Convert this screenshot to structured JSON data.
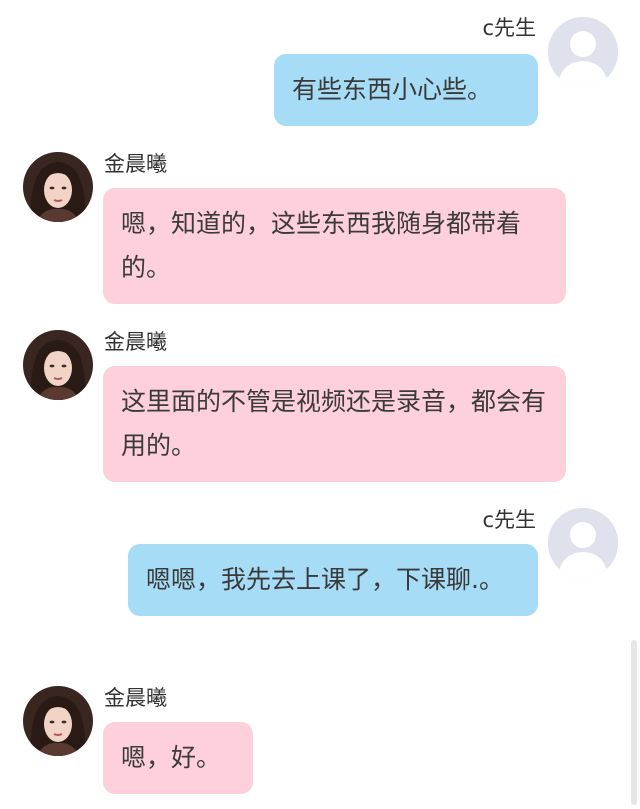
{
  "contacts": {
    "me": {
      "name": "c先生"
    },
    "other": {
      "name": "金晨曦"
    }
  },
  "messages": [
    {
      "sender": "c先生",
      "text": "有些东西小心些。"
    },
    {
      "sender": "金晨曦",
      "text": "嗯，知道的，这些东西我随身都带着的。"
    },
    {
      "sender": "金晨曦",
      "text": "这里面的不管是视频还是录音，都会有用的。"
    },
    {
      "sender": "c先生",
      "text": "嗯嗯，我先去上课了，下课聊.。"
    },
    {
      "sender": "金晨曦",
      "text": "嗯，好。"
    }
  ],
  "colors": {
    "outgoing_bubble": "#a7dcf6",
    "incoming_bubble": "#fdd0db",
    "text": "#3a3a3a"
  },
  "icons": {
    "default_avatar": "default-user-avatar-icon",
    "contact_avatar": "contact-photo-avatar"
  }
}
